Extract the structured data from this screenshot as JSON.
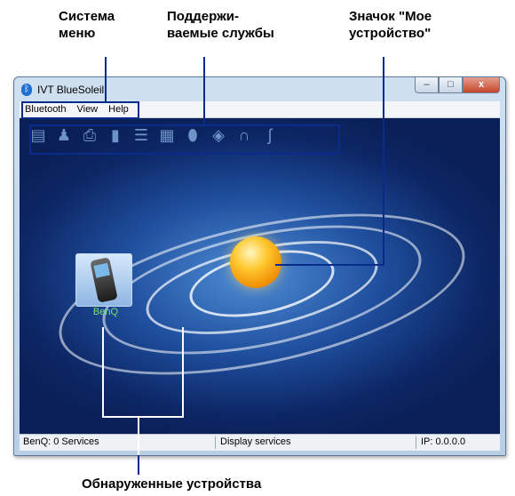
{
  "callouts": {
    "system_menu": "Система\nменю",
    "services": "Поддержи-\nваемые службы",
    "my_device": "Значок \"Мое\nустройство\"",
    "found_devices": "Обнаруженные устройства"
  },
  "window": {
    "title": "IVT BlueSoleil",
    "app_icon": "bluetooth-icon",
    "buttons": {
      "minimize": "–",
      "maximize": "□",
      "close": "x"
    }
  },
  "menu": [
    "Bluetooth",
    "View",
    "Help"
  ],
  "toolbar": {
    "icons": [
      "network-icon",
      "user-network-icon",
      "printer-icon",
      "serial-port-icon",
      "contacts-icon",
      "fax-icon",
      "mouse-icon",
      "file-transfer-icon",
      "headphones-icon",
      "headset-icon"
    ]
  },
  "device": {
    "label": "BenQ",
    "icon": "mobile-phone-icon"
  },
  "status": {
    "left": "BenQ: 0 Services",
    "middle": "Display services",
    "right": "IP: 0.0.0.0"
  },
  "colors": {
    "callout_line": "#0a2a8c",
    "device_label": "#78e070",
    "orb": "#f5a000"
  }
}
